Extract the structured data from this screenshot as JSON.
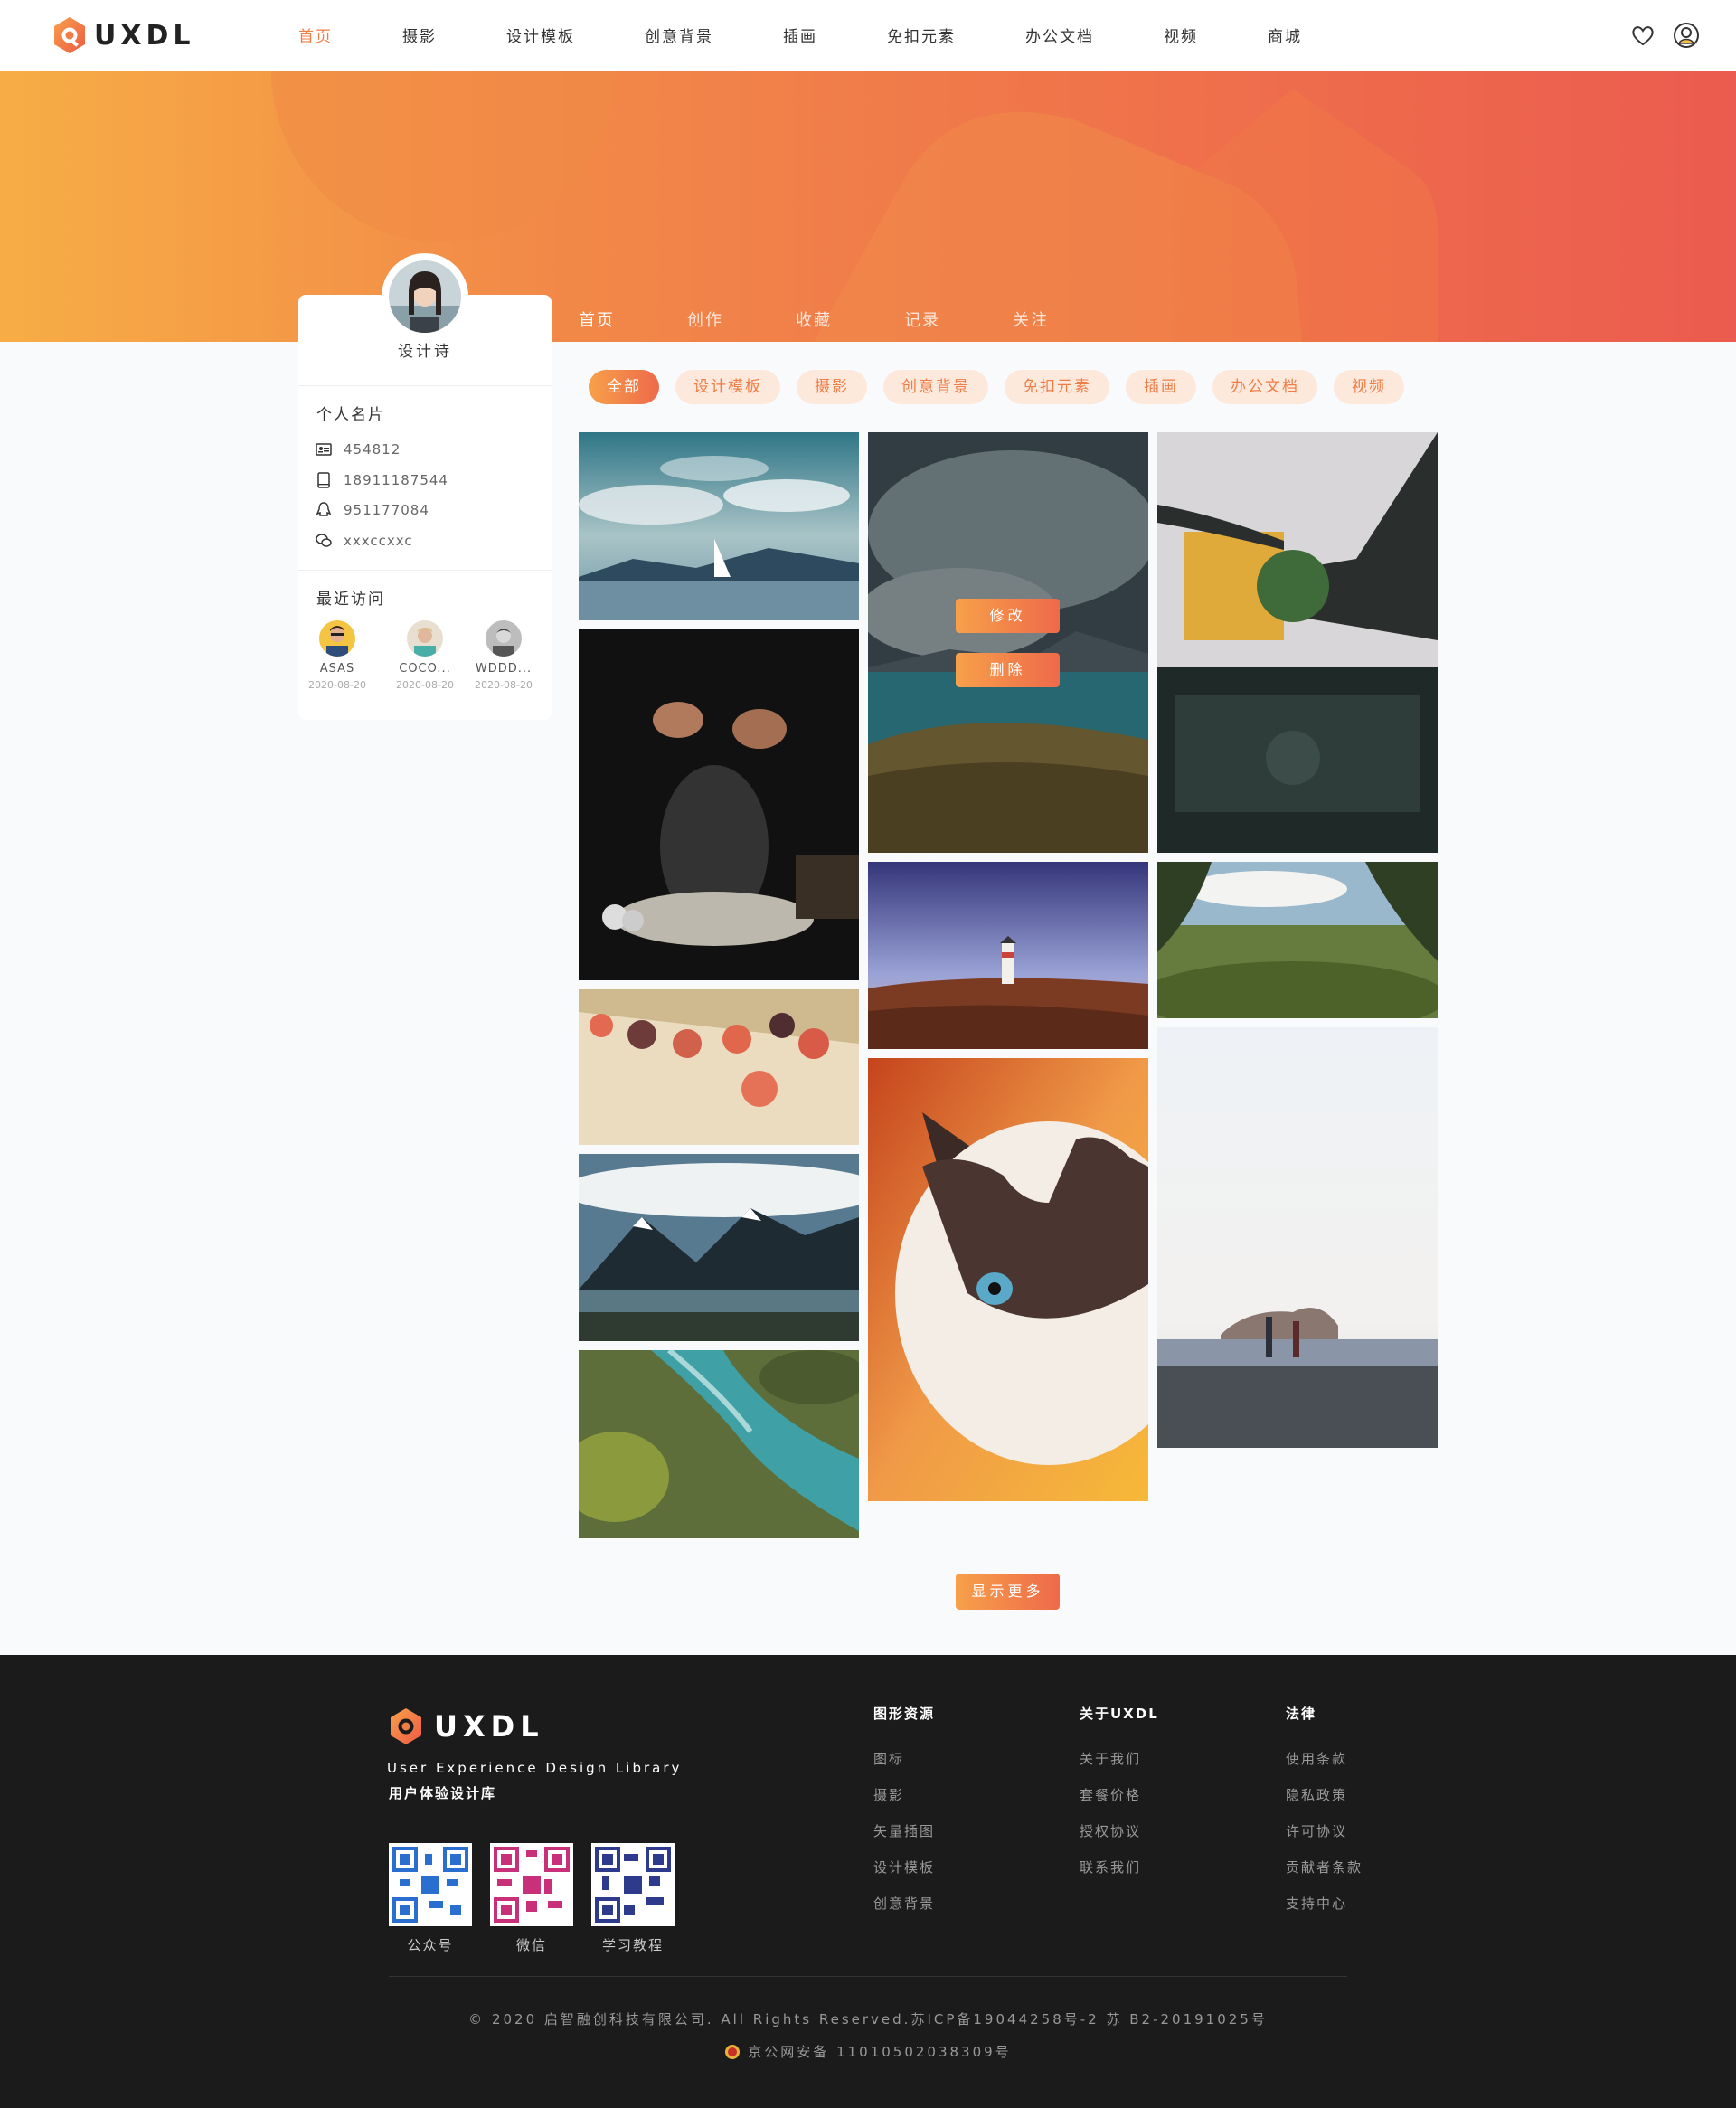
{
  "brand": {
    "name": "UXDL",
    "color_primary": "#ef7d45",
    "color_gradient_start": "#f7a04a",
    "color_gradient_end": "#ee6a4a"
  },
  "nav": {
    "items": [
      "首页",
      "摄影",
      "设计模板",
      "创意背景",
      "插画",
      "免扣元素",
      "办公文档",
      "视频",
      "商城"
    ],
    "active": "首页"
  },
  "header_icons": [
    "heart-icon",
    "user-icon"
  ],
  "profile": {
    "username": "设计诗",
    "card_title": "个人名片",
    "id": "454812",
    "phone": "18911187544",
    "qq": "951177084",
    "wechat": "xxxccxxc",
    "recent_title": "最近访问",
    "visitors": [
      {
        "name": "ASAS",
        "date": "2020-08-20"
      },
      {
        "name": "COCO...",
        "date": "2020-08-20"
      },
      {
        "name": "WDDD...",
        "date": "2020-08-20"
      }
    ]
  },
  "profile_tabs": [
    "首页",
    "创作",
    "收藏",
    "记录",
    "关注"
  ],
  "filters": {
    "items": [
      "全部",
      "设计模板",
      "摄影",
      "创意背景",
      "免扣元素",
      "插画",
      "办公文档",
      "视频"
    ],
    "active": "全部"
  },
  "overlay_actions": {
    "edit": "修改",
    "delete": "删除"
  },
  "load_more": "显示更多",
  "footer": {
    "logo": "UXDL",
    "tagline_en": "User Experience Design Library",
    "tagline_cn": "用户体验设计库",
    "qrcodes": [
      "公众号",
      "微信",
      "学习教程"
    ],
    "columns": [
      {
        "title": "图形资源",
        "links": [
          "图标",
          "摄影",
          "矢量插图",
          "设计模板",
          "创意背景"
        ]
      },
      {
        "title": "关于UXDL",
        "links": [
          "关于我们",
          "套餐价格",
          "授权协议",
          "联系我们"
        ]
      },
      {
        "title": "法律",
        "links": [
          "使用条款",
          "隐私政策",
          "许可协议",
          "贡献者条款",
          "支持中心"
        ]
      }
    ],
    "copyright": "© 2020 启智融创科技有限公司. All Rights Reserved.苏ICP备19044258号-2  苏 B2-20191025号",
    "beian": "京公网安备 11010502038309号"
  }
}
